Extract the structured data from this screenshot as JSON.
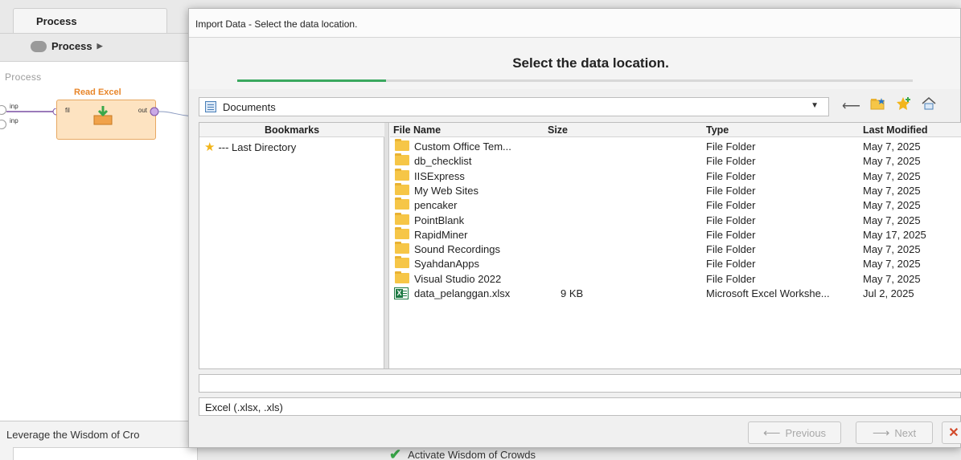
{
  "background": {
    "tab_label": "Process",
    "breadcrumb": "Process",
    "canvas_label": "Process",
    "operator": {
      "title": "Read Excel",
      "port_in": "fil",
      "port_out": "out"
    },
    "input_ports": [
      "inp",
      "inp"
    ],
    "wisdom_text": "Leverage the Wisdom of Cro",
    "activate_label": "Activate Wisdom of Crowds"
  },
  "dialog": {
    "title": "Import Data - Select the data location.",
    "banner_title": "Select the data location.",
    "progress_fraction": 0.22,
    "location": "Documents",
    "bookmarks_header": "Bookmarks",
    "bookmarks": [
      {
        "label": "--- Last Directory",
        "icon": "star-icon"
      }
    ],
    "columns": {
      "name": "File Name",
      "size": "Size",
      "type": "Type",
      "modified": "Last Modified"
    },
    "files": [
      {
        "name": "Custom Office Tem...",
        "size": "",
        "type": "File Folder",
        "modified": "May 7, 2025",
        "icon": "folder-icon"
      },
      {
        "name": "db_checklist",
        "size": "",
        "type": "File Folder",
        "modified": "May 7, 2025",
        "icon": "folder-icon"
      },
      {
        "name": "IISExpress",
        "size": "",
        "type": "File Folder",
        "modified": "May 7, 2025",
        "icon": "folder-icon"
      },
      {
        "name": "My Web Sites",
        "size": "",
        "type": "File Folder",
        "modified": "May 7, 2025",
        "icon": "folder-icon"
      },
      {
        "name": "pencaker",
        "size": "",
        "type": "File Folder",
        "modified": "May 7, 2025",
        "icon": "folder-icon"
      },
      {
        "name": "PointBlank",
        "size": "",
        "type": "File Folder",
        "modified": "May 7, 2025",
        "icon": "folder-icon"
      },
      {
        "name": "RapidMiner",
        "size": "",
        "type": "File Folder",
        "modified": "May 17, 2025",
        "icon": "folder-icon"
      },
      {
        "name": "Sound Recordings",
        "size": "",
        "type": "File Folder",
        "modified": "May 7, 2025",
        "icon": "folder-icon"
      },
      {
        "name": "SyahdanApps",
        "size": "",
        "type": "File Folder",
        "modified": "May 7, 2025",
        "icon": "folder-icon"
      },
      {
        "name": "Visual Studio 2022",
        "size": "",
        "type": "File Folder",
        "modified": "May 7, 2025",
        "icon": "folder-icon"
      },
      {
        "name": "data_pelanggan.xlsx",
        "size": "9 KB",
        "type": "Microsoft Excel Workshe...",
        "modified": "Jul 2, 2025",
        "icon": "excel-file-icon"
      }
    ],
    "file_name_value": "",
    "filter": "Excel (.xlsx, .xls)",
    "buttons": {
      "previous": "Previous",
      "next": "Next"
    }
  }
}
